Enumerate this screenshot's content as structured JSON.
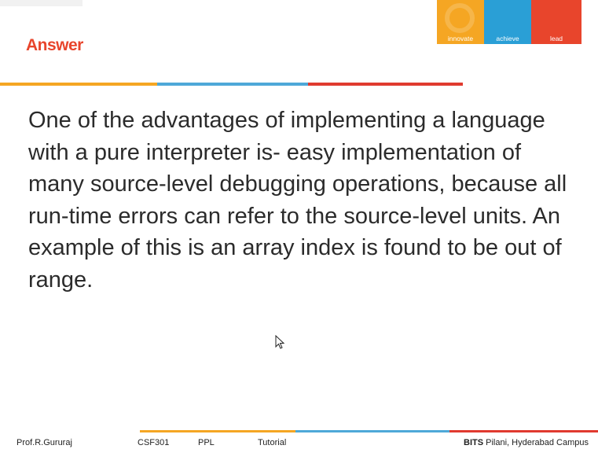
{
  "slide": {
    "title": "Answer",
    "body": "One of the advantages of implementing a language with a pure interpreter is- easy implementation of many source-level debugging operations, because all run-time errors can refer to the source-level units. An example of this is an array index is found to be out of range."
  },
  "logo": {
    "words": [
      "innovate",
      "achieve",
      "lead"
    ],
    "colors": [
      "#f5a623",
      "#2a9fd6",
      "#e8452c"
    ]
  },
  "footer": {
    "author": "Prof.R.Gururaj",
    "course": "CSF301",
    "subject": "PPL",
    "type": "Tutorial",
    "institute_bold": "BITS",
    "institute_rest": " Pilani, Hyderabad Campus"
  },
  "theme": {
    "title_color": "#e8452c",
    "rule_orange": "#f5a623",
    "rule_blue": "#4ea8d8",
    "rule_red": "#e03a2f"
  }
}
